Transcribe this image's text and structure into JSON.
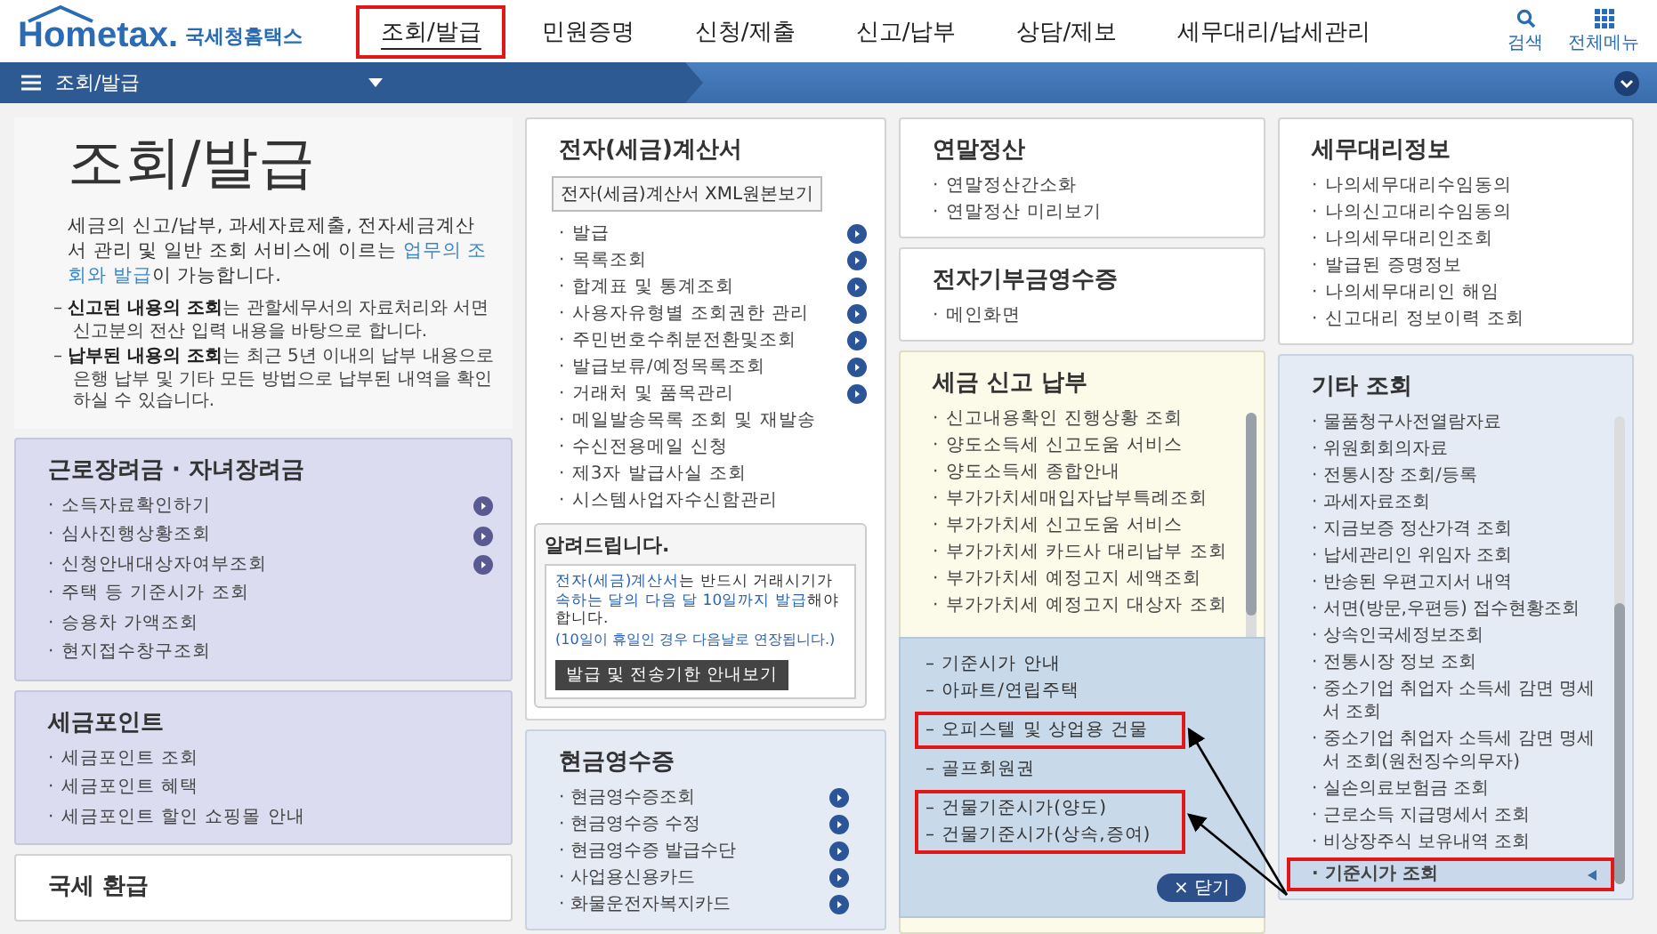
{
  "header": {
    "logo": "Hometax.",
    "site_name": "국세청홈택스",
    "search_label": "검색",
    "all_menu_label": "전체메뉴",
    "nav": [
      {
        "label": "조회/발급",
        "selected": true
      },
      {
        "label": "민원증명",
        "selected": false
      },
      {
        "label": "신청/제출",
        "selected": false
      },
      {
        "label": "신고/납부",
        "selected": false
      },
      {
        "label": "상담/제보",
        "selected": false
      },
      {
        "label": "세무대리/납세관리",
        "selected": false
      }
    ]
  },
  "breadcrumb": {
    "label": "조회/발급"
  },
  "intro": {
    "title": "조회/발급",
    "description": "세금의 신고/납부, 과세자료제출, 전자세금계산서 관리 및 일반 조회 서비스에 이르는 **업무의 조회와 발급**이 가능합니다.",
    "notes": [
      "– **신고된 내용의 조회**는 관할세무서의 자료처리와 서면신고분의 전산 입력 내용을 바탕으로 합니다.",
      "– **납부된 내용의 조회**는 최근 5년 이내의 납부 내용으로 은행 납부 및 기타 모든 방법으로 납부된 내역을 확인하실 수 있습니다."
    ]
  },
  "columns": [
    [
      {
        "title": "근로장려금 · 자녀장려금",
        "kind": "lavender",
        "items": [
          {
            "label": "· 소득자료확인하기",
            "arrow": true
          },
          {
            "label": "· 심사진행상황조회",
            "arrow": true
          },
          {
            "label": "· 신청안내대상자여부조회",
            "arrow": true
          },
          {
            "label": "· 주택 등 기준시가 조회",
            "arrow": false
          },
          {
            "label": "· 승용차 가액조회",
            "arrow": false
          },
          {
            "label": "· 현지접수창구조회",
            "arrow": false
          }
        ]
      },
      {
        "title": "세금포인트",
        "kind": "lavender",
        "items": [
          {
            "label": "· 세금포인트 조회"
          },
          {
            "label": "· 세금포인트 혜택"
          },
          {
            "label": "· 세금포인트 할인 쇼핑몰 안내"
          }
        ]
      },
      {
        "title": "국세 환급",
        "kind": "white"
      }
    ],
    [
      {
        "title": "전자(세금)계산서",
        "kind": "white",
        "button": "전자(세금)계산서 XML원본보기",
        "items": [
          {
            "label": "· 발급",
            "arrow": true
          },
          {
            "label": "· 목록조회",
            "arrow": true
          },
          {
            "label": "· 합계표 및 통계조회",
            "arrow": true
          },
          {
            "label": "· 사용자유형별 조회권한 관리",
            "arrow": true
          },
          {
            "label": "· 주민번호수취분전환및조회",
            "arrow": true
          },
          {
            "label": "· 발급보류/예정목록조회",
            "arrow": true
          },
          {
            "label": "· 거래처 및 품목관리",
            "arrow": true
          },
          {
            "label": "· 메일발송목록 조회 및 재발송",
            "arrow": false
          },
          {
            "label": "· 수신전용메일 신청",
            "arrow": false
          },
          {
            "label": "· 제3자 발급사실 조회",
            "arrow": false
          },
          {
            "label": "· 시스템사업자수신함관리",
            "arrow": false
          }
        ],
        "notice": {
          "title": "알려드립니다.",
          "text": "**전자(세금)계산서**는 반드시 거래시기가 **속하는 달의 다음 달 10일까지 발급**해야 합니다.",
          "note": "(10일이 휴일인 경우 다음날로 연장됩니다.)",
          "button": "발급 및 전송기한 안내보기"
        }
      },
      {
        "title": "현금영수증",
        "kind": "blue",
        "items": [
          {
            "label": "· 현금영수증조회",
            "arrow": true
          },
          {
            "label": "· 현금영수증 수정",
            "arrow": true
          },
          {
            "label": "· 현금영수증 발급수단",
            "arrow": true
          },
          {
            "label": "· 사업용신용카드",
            "arrow": true
          },
          {
            "label": "· 화물운전자복지카드",
            "arrow": true
          }
        ]
      }
    ],
    [
      {
        "title": "연말정산",
        "kind": "white",
        "items": [
          {
            "label": "· 연말정산간소화"
          },
          {
            "label": "· 연말정산 미리보기"
          }
        ]
      },
      {
        "title": "전자기부금영수증",
        "kind": "white",
        "items": [
          {
            "label": "· 메인화면"
          }
        ]
      },
      {
        "title": "세금 신고 납부",
        "kind": "cream",
        "scroll": true,
        "items": [
          {
            "label": "· 신고내용확인 진행상황 조회"
          },
          {
            "label": "· 양도소득세 신고도움 서비스"
          },
          {
            "label": "· 양도소득세 종합안내"
          },
          {
            "label": "· 부가가치세매입자납부특례조회"
          },
          {
            "label": "· 부가가치세 신고도움 서비스"
          },
          {
            "label": "· 부가가치세 카드사 대리납부 조회"
          },
          {
            "label": "· 부가가치세 예정고지 세액조회"
          },
          {
            "label": "· 부가가치세 예정고지 대상자 조회"
          }
        ],
        "popup": {
          "close": "× 닫기",
          "groups": [
            {
              "highlighted": false,
              "items": [
                "– 기준시가 안내",
                "– 아파트/연립주택"
              ]
            },
            {
              "highlighted": true,
              "items": [
                "– 오피스텔 및 상업용 건물"
              ]
            },
            {
              "highlighted": false,
              "items": [
                "– 골프회원권"
              ]
            },
            {
              "highlighted": true,
              "items": [
                "– 건물기준시가(양도)",
                "– 건물기준시가(상속,증여)"
              ]
            }
          ]
        }
      }
    ],
    [
      {
        "title": "세무대리정보",
        "kind": "white",
        "items": [
          {
            "label": "· 나의세무대리수임동의"
          },
          {
            "label": "· 나의신고대리수임동의"
          },
          {
            "label": "· 나의세무대리인조회"
          },
          {
            "label": "· 발급된 증명정보"
          },
          {
            "label": "· 나의세무대리인 해임"
          },
          {
            "label": "· 신고대리 정보이력 조회"
          }
        ]
      },
      {
        "title": "기타 조회",
        "kind": "blue",
        "scroll": true,
        "items": [
          {
            "label": "· 물품청구사전열람자료",
            "highlighted": false
          },
          {
            "label": "· 위원회회의자료",
            "highlighted": false
          },
          {
            "label": "· 전통시장 조회/등록",
            "highlighted": false
          },
          {
            "label": "· 과세자료조회",
            "highlighted": false
          },
          {
            "label": "· 지금보증 정산가격 조회",
            "highlighted": false
          },
          {
            "label": "· 납세관리인 위임자 조회",
            "highlighted": false
          },
          {
            "label": "· 반송된 우편고지서 내역",
            "highlighted": false
          },
          {
            "label": "· 서면(방문,우편등) 접수현황조회",
            "highlighted": false
          },
          {
            "label": "· 상속인국세정보조회",
            "highlighted": false
          },
          {
            "label": "· 전통시장 정보 조회",
            "highlighted": false
          },
          {
            "label": "· 중소기업 취업자 소득세 감면 명세서 조회",
            "highlighted": false
          },
          {
            "label": "· 중소기업 취업자 소득세 감면 명세서 조회(원천징수의무자)",
            "highlighted": false
          },
          {
            "label": "· 실손의료보험금 조회",
            "highlighted": false
          },
          {
            "label": "· 근로소득 지급명세서 조회",
            "highlighted": false
          },
          {
            "label": "· 비상장주식 보유내역 조회",
            "highlighted": false
          },
          {
            "label": "· 기준시가 조회",
            "highlighted": true
          }
        ]
      }
    ]
  ]
}
